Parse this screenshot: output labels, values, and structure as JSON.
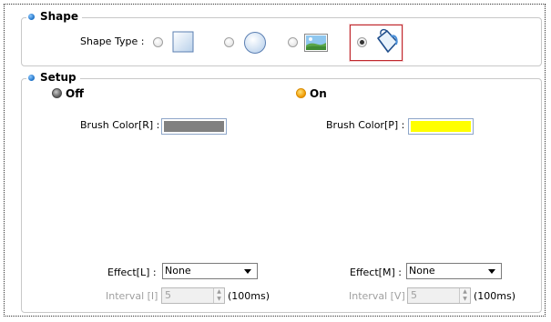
{
  "shape_group": {
    "title": "Shape",
    "shape_type_label": "Shape Type :",
    "options": [
      {
        "icon": "square-icon",
        "selected": false
      },
      {
        "icon": "circle-icon",
        "selected": false
      },
      {
        "icon": "image-icon",
        "selected": false
      },
      {
        "icon": "paint-bucket-icon",
        "selected": true
      }
    ]
  },
  "setup_group": {
    "title": "Setup",
    "off": {
      "label": "Off",
      "indicator_color": "#6e6e6e",
      "brush_label": "Brush Color[R] :",
      "brush_color": "#808080",
      "effect_label": "Effect[L] :",
      "effect_value": "None",
      "interval_label": "Interval [I] :",
      "interval_value": "5",
      "interval_unit": "(100ms)"
    },
    "on": {
      "label": "On",
      "indicator_color": "#f4a000",
      "brush_label": "Brush Color[P] :",
      "brush_color": "#ffff00",
      "effect_label": "Effect[M] :",
      "effect_value": "None",
      "interval_label": "Interval [V] :",
      "interval_value": "5",
      "interval_unit": "(100ms)"
    }
  },
  "colors": {
    "selection_border": "#c0272d",
    "group_bullet": "#1b6fc4"
  }
}
